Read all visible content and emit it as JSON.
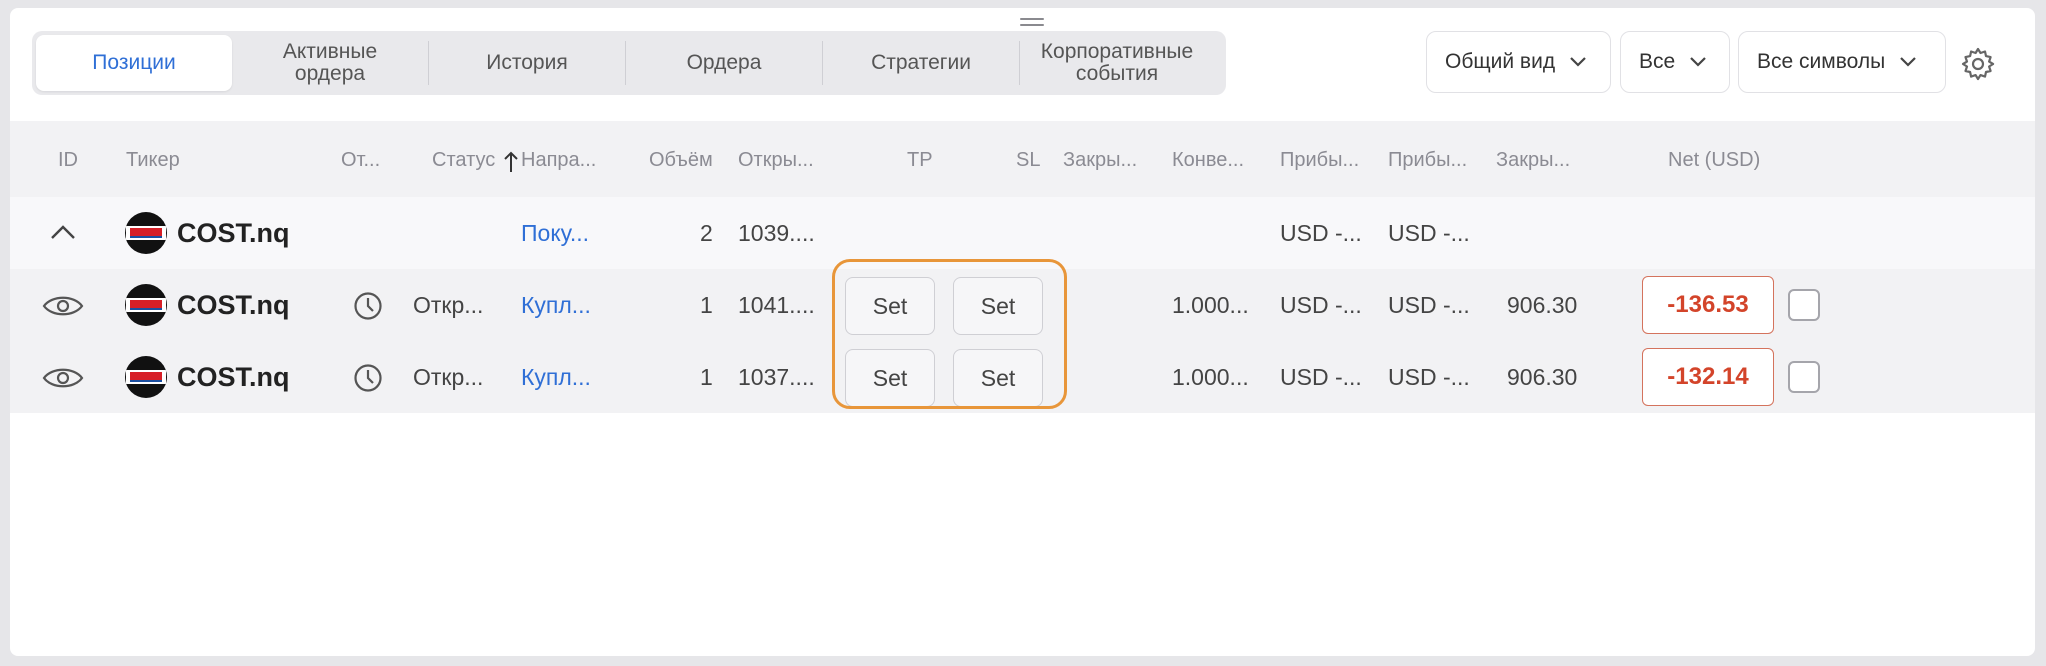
{
  "tabs": [
    {
      "label": "Позиции",
      "active": true
    },
    {
      "label": "Активные\nордера"
    },
    {
      "label": "История"
    },
    {
      "label": "Ордера"
    },
    {
      "label": "Стратегии"
    },
    {
      "label": "Корпоративные\nсобытия"
    }
  ],
  "filters": {
    "view": "Общий вид",
    "scope": "Все",
    "symbols": "Все символы"
  },
  "columns": {
    "id": "ID",
    "ticker": "Тикер",
    "ot": "От...",
    "status": "Статус",
    "direction": "Напра...",
    "volume": "Объём",
    "open": "Откры...",
    "tp": "TP",
    "sl": "SL",
    "close": "Закры...",
    "conv": "Конве...",
    "profit1": "Прибы...",
    "profit2": "Прибы...",
    "closed": "Закры...",
    "net": "Net (USD)"
  },
  "group": {
    "ticker": "COST.nq",
    "direction": "Поку...",
    "volume": "2",
    "open": "1039....",
    "profit1": "USD -...",
    "profit2": "USD -..."
  },
  "rows": [
    {
      "ticker": "COST.nq",
      "status": "Откр...",
      "direction": "Купл...",
      "volume": "1",
      "open": "1041....",
      "tp": "Set",
      "sl": "Set",
      "conv": "1.000...",
      "profit1": "USD -...",
      "profit2": "USD -...",
      "closed": "906.30",
      "net": "-136.53"
    },
    {
      "ticker": "COST.nq",
      "status": "Откр...",
      "direction": "Купл...",
      "volume": "1",
      "open": "1037....",
      "tp": "Set",
      "sl": "Set",
      "conv": "1.000...",
      "profit1": "USD -...",
      "profit2": "USD -...",
      "closed": "906.30",
      "net": "-132.14"
    }
  ],
  "colors": {
    "accent": "#2f6fd6",
    "negative": "#d3442a",
    "highlight": "#e8963a"
  }
}
